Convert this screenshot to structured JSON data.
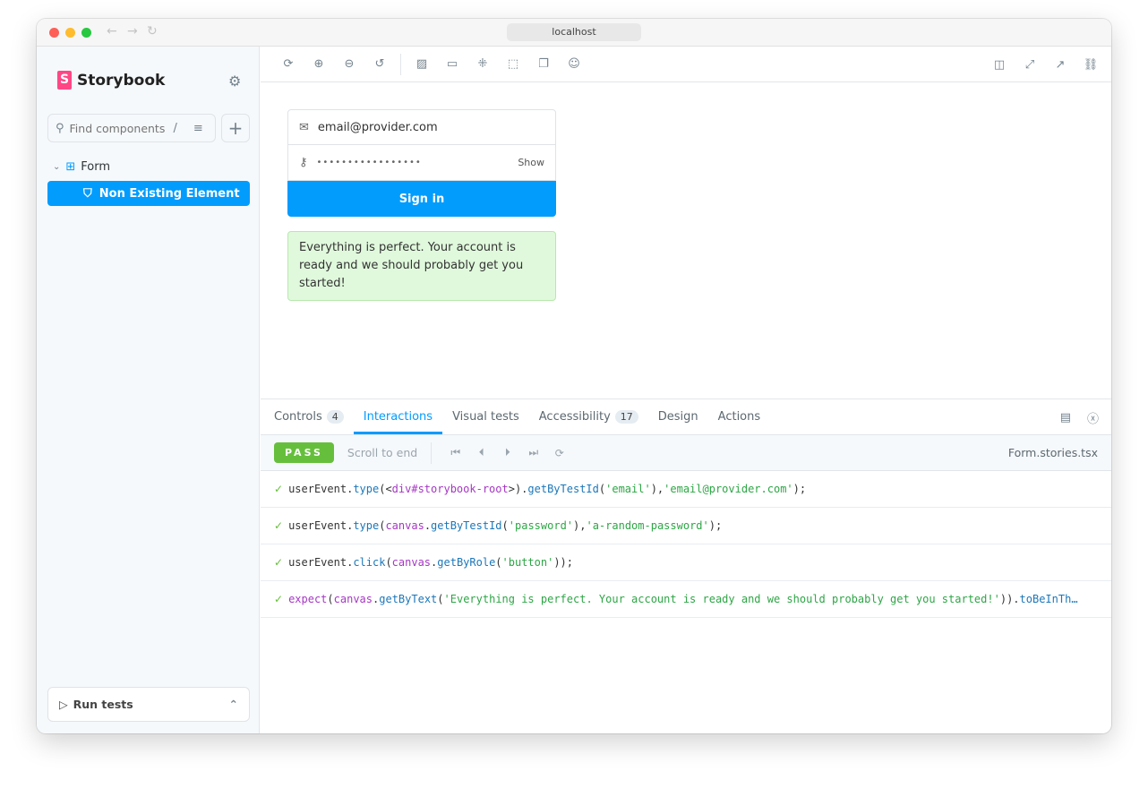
{
  "window": {
    "url": "localhost"
  },
  "sidebar": {
    "brand": "Storybook",
    "search_placeholder": "Find components",
    "search_shortcut": "/",
    "tree": {
      "group": "Form",
      "selected": "Non Existing Element"
    },
    "run_tests": "Run tests"
  },
  "canvas": {
    "email": "email@provider.com",
    "password_mask": "•••••••••••••••••",
    "show_label": "Show",
    "signin": "Sign in",
    "message": "Everything is perfect. Your account is ready and we should probably get you started!"
  },
  "panel": {
    "tabs": [
      {
        "label": "Controls",
        "badge": "4"
      },
      {
        "label": "Interactions",
        "active": true
      },
      {
        "label": "Visual tests"
      },
      {
        "label": "Accessibility",
        "badge": "17"
      },
      {
        "label": "Design"
      },
      {
        "label": "Actions"
      }
    ],
    "status": "PASS",
    "scroll_label": "Scroll to end",
    "file": "Form.stories.tsx",
    "steps": [
      [
        [
          "plain",
          "userEvent."
        ],
        [
          "fn",
          "type"
        ],
        [
          "plain",
          "(<"
        ],
        [
          "obj",
          "div#storybook-root"
        ],
        [
          "plain",
          ">)."
        ],
        [
          "fn",
          "getByTestId"
        ],
        [
          "plain",
          "("
        ],
        [
          "str",
          "'email'"
        ],
        [
          "plain",
          "), "
        ],
        [
          "str",
          "'email@provider.com'"
        ],
        [
          "plain",
          ");"
        ]
      ],
      [
        [
          "plain",
          "userEvent."
        ],
        [
          "fn",
          "type"
        ],
        [
          "plain",
          "("
        ],
        [
          "obj",
          "canvas"
        ],
        [
          "plain",
          "."
        ],
        [
          "fn",
          "getByTestId"
        ],
        [
          "plain",
          "("
        ],
        [
          "str",
          "'password'"
        ],
        [
          "plain",
          "), "
        ],
        [
          "str",
          "'a-random-password'"
        ],
        [
          "plain",
          ");"
        ]
      ],
      [
        [
          "plain",
          "userEvent."
        ],
        [
          "fn",
          "click"
        ],
        [
          "plain",
          "("
        ],
        [
          "obj",
          "canvas"
        ],
        [
          "plain",
          "."
        ],
        [
          "fn",
          "getByRole"
        ],
        [
          "plain",
          "("
        ],
        [
          "str",
          "'button'"
        ],
        [
          "plain",
          "));"
        ]
      ],
      [
        [
          "obj",
          "expect"
        ],
        [
          "plain",
          "("
        ],
        [
          "obj",
          "canvas"
        ],
        [
          "plain",
          "."
        ],
        [
          "fn",
          "getByText"
        ],
        [
          "plain",
          "("
        ],
        [
          "str",
          "'Everything is perfect. Your account is ready and we should probably get you started!'"
        ],
        [
          "plain",
          "))."
        ],
        [
          "fn",
          "toBeInTh…"
        ]
      ]
    ]
  },
  "colors": {
    "accent": "#029cfd",
    "pass": "#66bf3c",
    "brand": "#ff4785"
  }
}
